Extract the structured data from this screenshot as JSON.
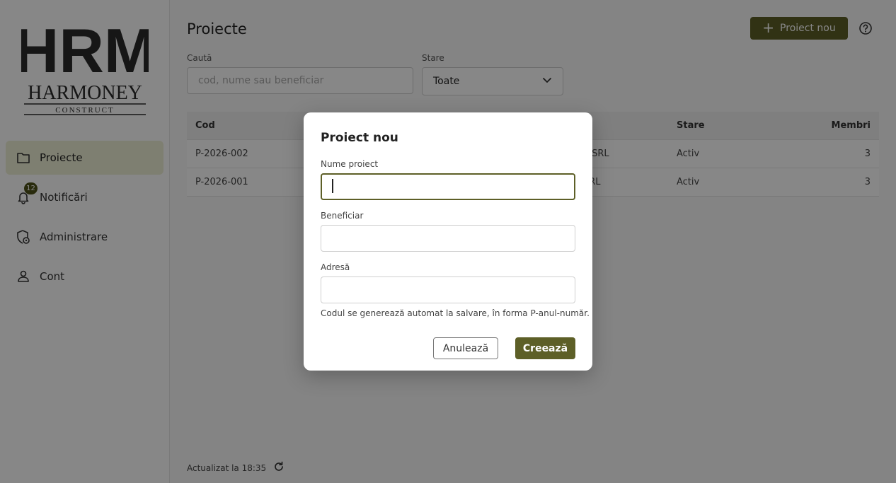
{
  "brand": {
    "logo_letters": "HRM",
    "logo_name": "HARMONEY",
    "logo_sub": "CONSTRUCT"
  },
  "sidebar": {
    "items": [
      {
        "label": "Proiecte",
        "icon": "folder-icon",
        "active": true
      },
      {
        "label": "Notificări",
        "icon": "bell-icon",
        "badge": "12"
      },
      {
        "label": "Administrare",
        "icon": "admin-shield-icon"
      },
      {
        "label": "Cont",
        "icon": "user-icon"
      }
    ]
  },
  "header": {
    "title": "Proiecte",
    "new_button": "Proiect nou",
    "help_icon": "help-circle-icon"
  },
  "filters": {
    "search_label": "Caută",
    "search_placeholder": "cod, nume sau beneficiar",
    "status_label": "Stare",
    "status_value": "Toate"
  },
  "table": {
    "columns": {
      "cod": "Cod",
      "stare": "Stare",
      "membri": "Membri"
    },
    "rows": [
      {
        "cod": "P-2026-002",
        "beneficiar_visible": "e SRL",
        "stare": "Activ",
        "membri": "3"
      },
      {
        "cod": "P-2026-001",
        "beneficiar_visible": "SRL",
        "stare": "Activ",
        "membri": "3"
      }
    ]
  },
  "footer": {
    "updated": "Actualizat la 18:35"
  },
  "modal": {
    "title": "Proiect nou",
    "name_label": "Nume proiect",
    "name_value": "",
    "beneficiary_label": "Beneficiar",
    "beneficiary_value": "",
    "address_label": "Adresă",
    "address_value": "",
    "hint": "Codul se generează automat la salvare, în forma P-anul-număr.",
    "cancel": "Anulează",
    "create": "Creează"
  },
  "colors": {
    "accent": "#5d5f27",
    "active_nav": "#eef0d6",
    "logo_dark": "#2b2b2b",
    "logo_olive": "#6b6b2c"
  }
}
